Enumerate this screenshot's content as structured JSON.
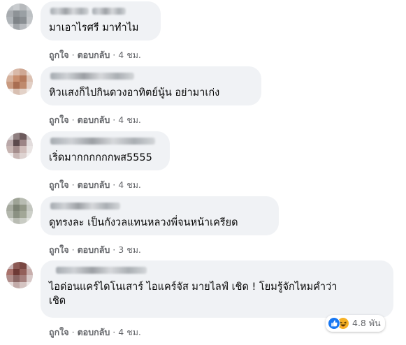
{
  "comments": [
    {
      "text_lines": [
        "มาเอาไรศรี มาทำไม"
      ],
      "like": "ถูกใจ",
      "reply": "ตอบกลับ",
      "time": "4 ชม."
    },
    {
      "text_lines": [
        "หิวแสงก็ไปกินดวงอาทิตย์นู้น อย่ามาเก่ง"
      ],
      "like": "ถูกใจ",
      "reply": "ตอบกลับ",
      "time": "4 ชม."
    },
    {
      "text_lines": [
        "เริ่ดมากกกกกกพส5555"
      ],
      "like": "ถูกใจ",
      "reply": "ตอบกลับ",
      "time": "4 ชม."
    },
    {
      "text_lines": [
        "ดูทรงละ เป็นกังวลแทนหลวงพี่จนหน้าเครียด"
      ],
      "like": "ถูกใจ",
      "reply": "ตอบกลับ",
      "time": "3 ชม."
    },
    {
      "text_lines": [
        "ไอด่อนแคร์ไดโนเสาร์ ไอแคร์จัส มายไลฟ์ เชิด ! โยมรู้จักไหมคำว่า",
        "เชิด"
      ],
      "like": "ถูกใจ",
      "reply": "ตอบกลับ",
      "time": "4 ชม.",
      "reactions": {
        "icons": [
          "like-icon",
          "haha-icon"
        ],
        "count": "4.8 พัน"
      }
    }
  ],
  "separator": "·",
  "colors": {
    "bubble": "#f0f2f5",
    "action_text": "#65676b",
    "like_blue": "#1877f2",
    "haha_yellow": "#f7b125"
  }
}
